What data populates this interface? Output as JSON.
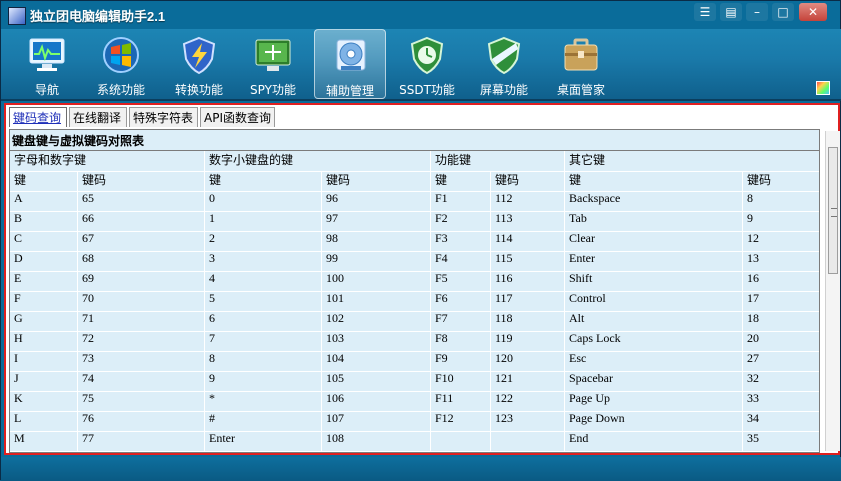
{
  "app": {
    "title": "独立团电脑编辑助手2.1"
  },
  "window_controls": [
    "☰",
    "▤",
    "–",
    "□",
    "✕"
  ],
  "toolbar": [
    {
      "label": "导航",
      "icon": "monitor-icon"
    },
    {
      "label": "系统功能",
      "icon": "windows-icon"
    },
    {
      "label": "转换功能",
      "icon": "shield-lightning-icon"
    },
    {
      "label": "SPY功能",
      "icon": "screen-spy-icon"
    },
    {
      "label": "辅助管理",
      "icon": "disc-icon",
      "active": true
    },
    {
      "label": "SSDT功能",
      "icon": "shield-clock-icon"
    },
    {
      "label": "屏幕功能",
      "icon": "shield-stripe-icon"
    },
    {
      "label": "桌面管家",
      "icon": "briefcase-icon"
    }
  ],
  "tabs": [
    {
      "label": "键码查询",
      "active": true
    },
    {
      "label": "在线翻译"
    },
    {
      "label": "特殊字符表"
    },
    {
      "label": "API函数查询"
    }
  ],
  "panel": {
    "title": "键盘键与虚拟键码对照表",
    "groups": [
      "字母和数字键",
      "数字小键盘的键",
      "功能键",
      "其它键"
    ],
    "headers": [
      "键",
      "键码",
      "键",
      "键码",
      "键",
      "键码",
      "键",
      "键码"
    ],
    "rows": [
      [
        "A",
        "65",
        "0",
        "96",
        "F1",
        "112",
        "Backspace",
        "8"
      ],
      [
        "B",
        "66",
        "1",
        "97",
        "F2",
        "113",
        "Tab",
        "9"
      ],
      [
        "C",
        "67",
        "2",
        "98",
        "F3",
        "114",
        "Clear",
        "12"
      ],
      [
        "D",
        "68",
        "3",
        "99",
        "F4",
        "115",
        "Enter",
        "13"
      ],
      [
        "E",
        "69",
        "4",
        "100",
        "F5",
        "116",
        "Shift",
        "16"
      ],
      [
        "F",
        "70",
        "5",
        "101",
        "F6",
        "117",
        "Control",
        "17"
      ],
      [
        "G",
        "71",
        "6",
        "102",
        "F7",
        "118",
        "Alt",
        "18"
      ],
      [
        "H",
        "72",
        "7",
        "103",
        "F8",
        "119",
        "Caps Lock",
        "20"
      ],
      [
        "I",
        "73",
        "8",
        "104",
        "F9",
        "120",
        "Esc",
        "27"
      ],
      [
        "J",
        "74",
        "9",
        "105",
        "F10",
        "121",
        "Spacebar",
        "32"
      ],
      [
        "K",
        "75",
        "*",
        "106",
        "F11",
        "122",
        "Page Up",
        "33"
      ],
      [
        "L",
        "76",
        "#",
        "107",
        "F12",
        "123",
        "Page Down",
        "34"
      ],
      [
        "M",
        "77",
        "Enter",
        "108",
        "",
        "",
        "End",
        "35"
      ]
    ]
  },
  "colors": {
    "accent_border": "#e02020",
    "grid_bg": "#dceef8",
    "toolbar_bg": "#1a7aaa",
    "active_tab_text": "#1f2fb8"
  }
}
